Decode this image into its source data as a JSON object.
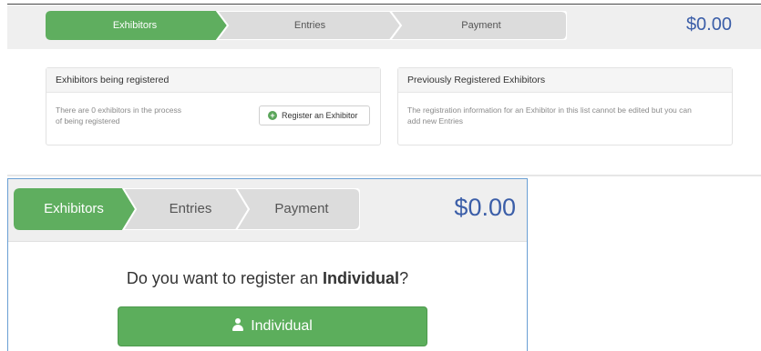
{
  "top_view": {
    "steps": [
      "Exhibitors",
      "Entries",
      "Payment"
    ],
    "active_step": "Exhibitors",
    "total": "$0.00",
    "panel_left": {
      "title": "Exhibitors being registered",
      "text_line1": "There are 0 exhibitors in the process",
      "text_line2": "of being registered",
      "button_label": "Register an Exhibitor"
    },
    "panel_right": {
      "title": "Previously Registered Exhibitors",
      "text_line1": "The registration information for an Exhibitor in this list cannot be edited but you can",
      "text_line2": "add new Entries"
    }
  },
  "bottom_view": {
    "steps": [
      "Exhibitors",
      "Entries",
      "Payment"
    ],
    "active_step": "Exhibitors",
    "total": "$0.00",
    "question_prefix": "Do you want to register an ",
    "question_bold": "Individual",
    "question_suffix": "?",
    "button_label": "Individual"
  },
  "colors": {
    "active_step": "#5fae5f",
    "inactive_step": "#dcdcdc",
    "price_text": "#3b5ea8",
    "primary_button": "#5cae5c"
  },
  "icons": [
    "plus-circle-icon",
    "user-icon"
  ]
}
